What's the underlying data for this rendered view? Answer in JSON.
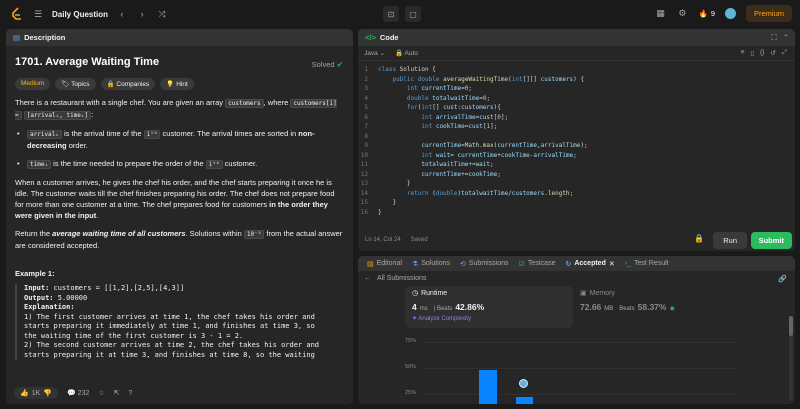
{
  "topbar": {
    "title": "Daily Question",
    "streak": "9",
    "premium": "Premium",
    "colors": {
      "accent": "#ffa116"
    }
  },
  "description": {
    "tab": "Description",
    "title": "1701. Average Waiting Time",
    "status": "Solved",
    "tags": [
      "Medium",
      "Topics",
      "Companies",
      "Hint"
    ],
    "p1a": "There is a restaurant with a single chef. You are given an array ",
    "p1code1": "customers",
    "p1b": ", where ",
    "p1code2": "customers[i] =",
    "p1code3": "[arrivalᵢ, timeᵢ]",
    "p1c": ":",
    "b1code": "arrivalᵢ",
    "b1a": " is the arrival time of the ",
    "b1code2": "iᵗʰ",
    "b1b": " customer. The arrival times are sorted in ",
    "b1bold": "non-decreasing",
    "b1c": " order.",
    "b2code": "timeᵢ",
    "b2a": " is the time needed to prepare the order of the ",
    "b2code2": "iᵗʰ",
    "b2b": " customer.",
    "p2": "When a customer arrives, he gives the chef his order, and the chef starts preparing it once he is idle. The customer waits till the chef finishes preparing his order. The chef does not prepare food for more than one customer at a time. The chef prepares food for customers ",
    "p2bold": "in the order they were given in the input",
    "p2end": ".",
    "p3a": "Return the ",
    "p3em": "average waiting time of all customers",
    "p3b": ". Solutions within ",
    "p3code": "10⁻⁵",
    "p3c": " from the actual answer are considered accepted.",
    "example_title": "Example 1:",
    "ex_input_label": "Input:",
    "ex_input": " customers = [[1,2],[2,5],[4,3]]",
    "ex_output_label": "Output:",
    "ex_output": " 5.00000",
    "ex_expl_label": "Explanation:",
    "ex_expl1": "1) The first customer arrives at time 1, the chef takes his order and",
    "ex_expl2": "starts preparing it immediately at time 1, and finishes at time 3, so",
    "ex_expl3": "the waiting time of the first customer is 3 - 1 = 2.",
    "ex_expl4": "2) The second customer arrives at time 2, the chef takes his order and",
    "ex_expl5": "starts preparing it at time 3, and finishes at time 8, so the waiting",
    "likes": "1K",
    "comments": "232"
  },
  "code": {
    "tab": "Code",
    "language": "Java",
    "autosave": "Auto",
    "lines": [
      "class Solution {",
      "    public double averageWaitingTime(int[][] customers) {",
      "        int currentTime=0;",
      "        double totalwaitTime=0;",
      "        for(int[] cust:customers){",
      "            int arrivalTime=cust[0];",
      "            int cookTime=cust[1];",
      "",
      "            currentTime=Math.max(currentTime,arrivalTime);",
      "            int wait= currentTime+cookTime-arrivalTime;",
      "            totalwaitTime+=wait;",
      "            currentTime+=cookTime;",
      "        }",
      "        return (double)totalwaitTime/customers.length;",
      "    }",
      "}"
    ],
    "cursor": "Ln 14, Col 24",
    "saved": "Saved",
    "run": "Run",
    "submit": "Submit"
  },
  "results": {
    "tabs": [
      "Editorial",
      "Solutions",
      "Submissions",
      "Testcase",
      "Accepted",
      "Test Result"
    ],
    "back": "All Submissions",
    "runtime_label": "Runtime",
    "runtime_value": "4",
    "runtime_unit": "ms",
    "runtime_beats_label": "Beats",
    "runtime_beats": "42.86%",
    "analyze": "Analyze Complexity",
    "memory_label": "Memory",
    "memory_value": "72.66",
    "memory_unit": "MB",
    "memory_beats_label": "Beats",
    "memory_beats": "58.37%",
    "y_ticks": [
      "75%",
      "50%",
      "25%"
    ]
  }
}
